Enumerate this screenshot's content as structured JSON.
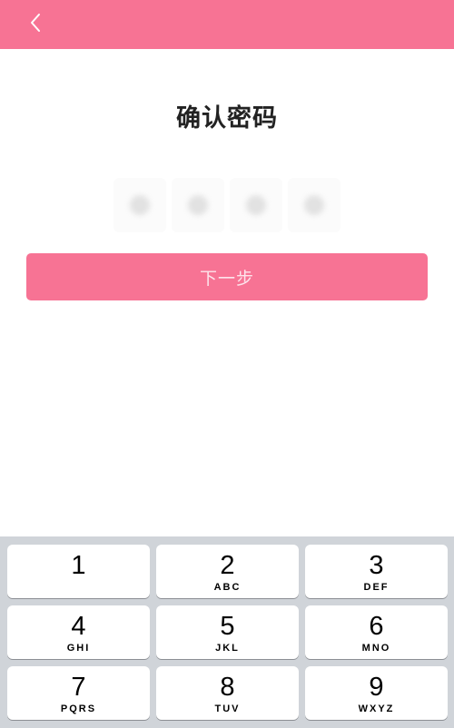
{
  "theme": {
    "accent": "#f77394",
    "keypad_bg": "#d0d4d9"
  },
  "header": {
    "back_icon": "chevron-left-icon"
  },
  "main": {
    "title": "确认密码",
    "pin_length": 4,
    "next_label": "下一步"
  },
  "keypad": {
    "keys": [
      {
        "digit": "1",
        "letters": ""
      },
      {
        "digit": "2",
        "letters": "ABC"
      },
      {
        "digit": "3",
        "letters": "DEF"
      },
      {
        "digit": "4",
        "letters": "GHI"
      },
      {
        "digit": "5",
        "letters": "JKL"
      },
      {
        "digit": "6",
        "letters": "MNO"
      },
      {
        "digit": "7",
        "letters": "PQRS"
      },
      {
        "digit": "8",
        "letters": "TUV"
      },
      {
        "digit": "9",
        "letters": "WXYZ"
      }
    ]
  }
}
